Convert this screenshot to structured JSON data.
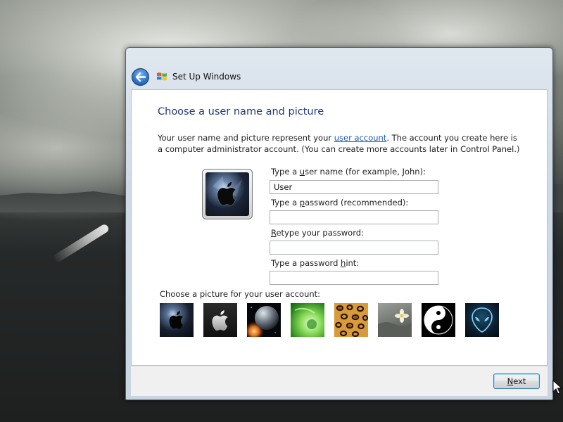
{
  "window": {
    "title": "Set Up Windows"
  },
  "page": {
    "heading": "Choose a user name and picture",
    "desc_before_link": "Your user name and picture represent your ",
    "desc_link": "user account",
    "desc_after_link": ". The account you create here is a computer administrator account. (You can create more accounts later in Control Panel.)"
  },
  "form": {
    "username_label_pre": "Type a ",
    "username_label_key": "u",
    "username_label_post": "ser name (for example, John):",
    "username_value": "User",
    "password_label_pre": "Type a ",
    "password_label_key": "p",
    "password_label_post": "assword (recommended):",
    "password_value": "",
    "retype_label_key": "R",
    "retype_label_post": "etype your password:",
    "retype_value": "",
    "hint_label_pre": "Type a password ",
    "hint_label_key": "h",
    "hint_label_post": "int:",
    "hint_value": ""
  },
  "pictures": {
    "label": "Choose a picture for your user account:",
    "items": [
      "apple-dark",
      "apple-silver",
      "planet",
      "green-abstract",
      "leopard",
      "flower",
      "yin-yang",
      "alien"
    ]
  },
  "footer": {
    "next_key": "N",
    "next_post": "ext"
  },
  "colors": {
    "heading": "#1e3b78",
    "link": "#1a5cb4",
    "button_border": "#3c7fb1"
  }
}
